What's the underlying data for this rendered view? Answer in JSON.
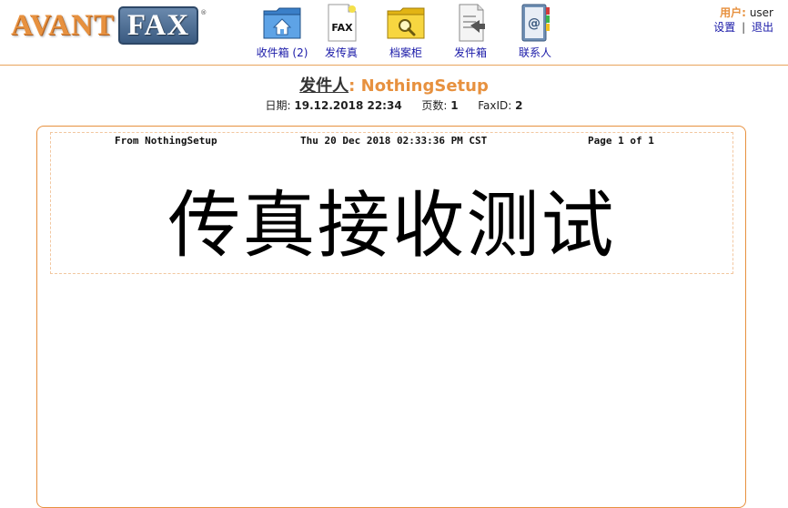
{
  "logo": {
    "avant": "AVANT",
    "fax": "FAX",
    "reg": "®"
  },
  "nav": {
    "inbox": "收件箱 (2)",
    "send": "发传真",
    "archive": "档案柜",
    "outbox": "发件箱",
    "contacts": "联系人"
  },
  "user": {
    "label": "用户:",
    "name": "user",
    "settings": "设置",
    "separator": "|",
    "logout": "退出"
  },
  "fax": {
    "sender_label": "发件人",
    "colon": ":",
    "sender": "NothingSetup",
    "date_label": "日期:",
    "date": "19.12.2018 22:34",
    "pages_label": "页数:",
    "pages": "1",
    "id_label": "FaxID:",
    "id": "2"
  },
  "page_image": {
    "header_from": "From NothingSetup",
    "header_date": "Thu 20 Dec 2018 02:33:36 PM CST",
    "header_page": "Page 1 of 1",
    "body_text": "传真接收测试"
  },
  "colors": {
    "accent": "#e7913f",
    "link": "#1a1aa8",
    "logo_fax_bg": "#4a6a90"
  },
  "icons": {
    "inbox": "inbox-folder-icon",
    "send": "fax-page-icon",
    "archive": "archive-folder-icon",
    "outbox": "outbox-document-icon",
    "contacts": "address-book-icon"
  }
}
